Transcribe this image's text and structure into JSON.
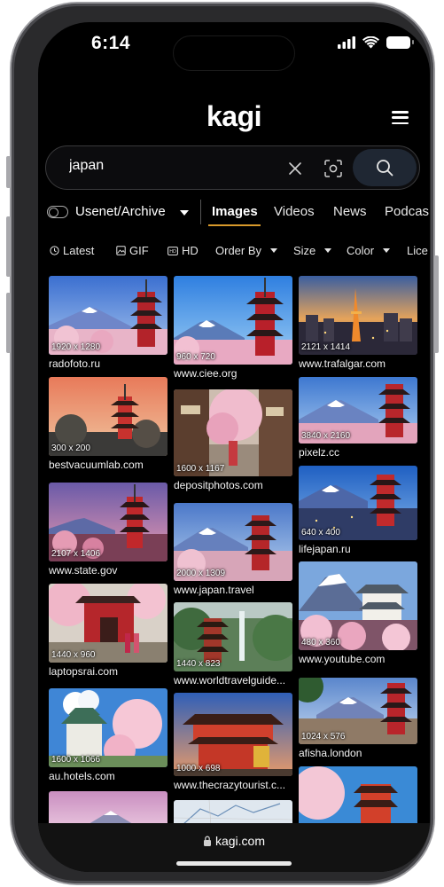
{
  "status": {
    "time": "6:14"
  },
  "header": {
    "logo": "kagi"
  },
  "search": {
    "query": "japan"
  },
  "tabs": {
    "usenet_label": "Usenet/Archive",
    "items": [
      {
        "label": "Images",
        "active": true
      },
      {
        "label": "Videos"
      },
      {
        "label": "News"
      },
      {
        "label": "Podcas"
      }
    ]
  },
  "filters": {
    "latest": "Latest",
    "gif": "GIF",
    "hd": "HD",
    "order_by": "Order By",
    "size": "Size",
    "color": "Color",
    "license": "Lice"
  },
  "results": [
    {
      "dims": "1920 x 1280",
      "domain": "radofoto.ru",
      "icon": "fuji-pagoda-image"
    },
    {
      "dims": "300 x 200",
      "domain": "bestvacuumlab.com",
      "icon": "pagoda-sunset-image"
    },
    {
      "dims": "2107 x 1406",
      "domain": "www.state.gov",
      "icon": "fuji-pagoda-dusk-image"
    },
    {
      "dims": "1440 x 960",
      "domain": "laptopsrai.com",
      "icon": "temple-gate-image"
    },
    {
      "dims": "1600 x 1066",
      "domain": "au.hotels.com",
      "icon": "osaka-castle-image"
    },
    {
      "dims": "960 x 720",
      "domain": "www.ciee.org",
      "icon": "fuji-pagoda-image"
    },
    {
      "dims": "1600 x 1167",
      "domain": "depositphotos.com",
      "icon": "kyoto-street-image"
    },
    {
      "dims": "2000 x 1309",
      "domain": "www.japan.travel",
      "icon": "fuji-pagoda-image"
    },
    {
      "dims": "1440 x 823",
      "domain": "www.worldtravelguide...",
      "icon": "pagoda-waterfall-image"
    },
    {
      "dims": "1000 x 698",
      "domain": "www.thecrazytourist.c...",
      "icon": "red-temple-image"
    },
    {
      "dims": "2121 x 1414",
      "domain": "www.trafalgar.com",
      "icon": "tokyo-tower-image"
    },
    {
      "dims": "3840 x 2160",
      "domain": "pixelz.cc",
      "icon": "fuji-pagoda-image"
    },
    {
      "dims": "640 x 400",
      "domain": "lifejapan.ru",
      "icon": "fuji-pagoda-night-image"
    },
    {
      "dims": "480 x 360",
      "domain": "www.youtube.com",
      "icon": "himeji-castle-image"
    },
    {
      "dims": "1024 x 576",
      "domain": "afisha.london",
      "icon": "fuji-pagoda-image"
    }
  ],
  "bottom": {
    "url": "kagi.com"
  },
  "colors": {
    "accent": "#d99a2b",
    "background": "#000000"
  }
}
